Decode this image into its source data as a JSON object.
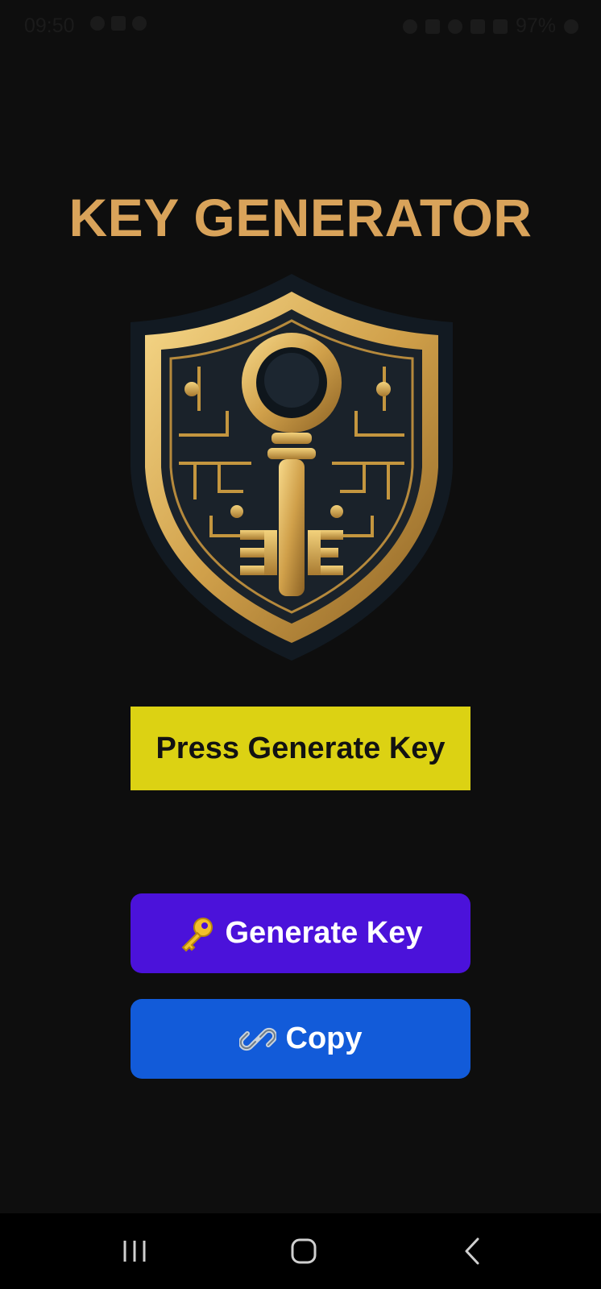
{
  "status_bar": {
    "time": "09:50",
    "battery": "97%",
    "left_icons": [
      "screen-recorder-icon",
      "image-icon",
      "person-icon"
    ],
    "right_icons": [
      "alarm-icon",
      "bluetooth-icon",
      "wifi-icon",
      "volte-icon",
      "signal-icon",
      "charging-battery-icon"
    ]
  },
  "app": {
    "title": "KEY GENERATOR",
    "logo": "shield-key-emblem",
    "key_display": "Press Generate Key",
    "generate_button": {
      "icon": "key-icon",
      "label": "Generate Key"
    },
    "copy_button": {
      "icon": "link-icon",
      "label": "Copy"
    }
  },
  "nav_bar": {
    "items": [
      "recent-apps-icon",
      "home-icon",
      "back-icon"
    ]
  },
  "colors": {
    "background": "#0e0e0e",
    "title": "#d9a35a",
    "key_display_bg": "#dcd213",
    "generate_button_bg": "#4b12da",
    "copy_button_bg": "#125bd9"
  }
}
